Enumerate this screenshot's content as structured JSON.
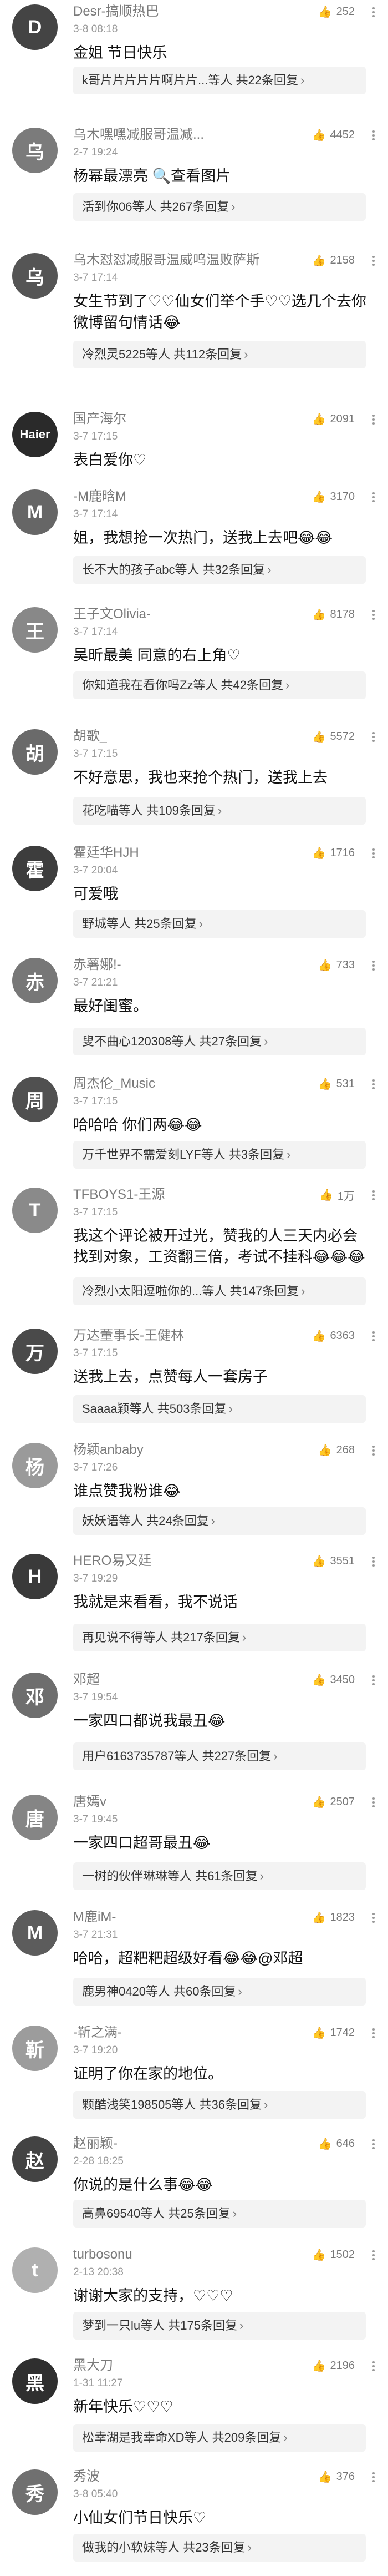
{
  "comments": [
    {
      "user": "Desr-搞顺热巴",
      "ts": "3-8 08:18",
      "likes": "252",
      "text": "金姐 节日快乐",
      "reply": "k哥片片片片片啊片片...等人  共22条回复"
    },
    {
      "user": "乌木嘿嘿减服哥温减...",
      "ts": "2-7 19:24",
      "likes": "4452",
      "text": "杨幂最漂亮 🔍查看图片",
      "reply": "活到你06等人  共267条回复"
    },
    {
      "user": "乌木怼怼减服哥温威呜温败萨斯",
      "ts": "3-7 17:14",
      "likes": "2158",
      "text": "女生节到了♡♡仙女们举个手♡♡选几个去你微博留句情话😂",
      "reply": "冷烈灵5225等人  共112条回复"
    },
    {
      "user": "国产海尔",
      "ts": "3-7 17:15",
      "likes": "2091",
      "text": "表白爱你♡",
      "reply": ""
    },
    {
      "user": "-M鹿晗M",
      "ts": "3-7 17:14",
      "likes": "3170",
      "text": "姐，我想抢一次热门，送我上去吧😂😂",
      "reply": "长不大的孩子abc等人  共32条回复"
    },
    {
      "user": "王子文Olivia-",
      "ts": "3-7 17:14",
      "likes": "8178",
      "text": "吴昕最美 同意的右上角♡",
      "reply": "你知道我在看你吗Zz等人  共42条回复"
    },
    {
      "user": "胡歌_",
      "ts": "3-7 17:15",
      "likes": "5572",
      "text": "不好意思，我也来抢个热门，送我上去",
      "reply": "花吃喵等人  共109条回复"
    },
    {
      "user": "霍廷华HJH",
      "ts": "3-7 20:04",
      "likes": "1716",
      "text": "可爱哦",
      "reply": "野城等人  共25条回复"
    },
    {
      "user": "赤薯娜!-",
      "ts": "3-7 21:21",
      "likes": "733",
      "text": "最好闺蜜。",
      "reply": "叟不曲心120308等人  共27条回复"
    },
    {
      "user": "周杰伦_Music",
      "ts": "3-7 17:15",
      "likes": "531",
      "text": "哈哈哈 你们两😂😂",
      "reply": "万千世界不需爱刻LYF等人  共3条回复"
    },
    {
      "user": "TFBOYS1-王源",
      "ts": "3-7 17:15",
      "likes": "1万",
      "text": "我这个评论被开过光，赞我的人三天内必会找到对象，工资翻三倍，考试不挂科😂😂😂",
      "reply": "冷烈小太阳逗啦你的...等人  共147条回复"
    },
    {
      "user": "万达董事长-王健林",
      "ts": "3-7 17:15",
      "likes": "6363",
      "text": "送我上去，点赞每人一套房子",
      "reply": "Saaaa颖等人  共503条回复"
    },
    {
      "user": "杨颖anbaby",
      "ts": "3-7 17:26",
      "likes": "268",
      "text": "谁点赞我粉谁😂",
      "reply": "妖妖语等人  共24条回复"
    },
    {
      "user": "HERO易又廷",
      "ts": "3-7 19:29",
      "likes": "3551",
      "text": "我就是来看看，我不说话",
      "reply": "再见说不得等人  共217条回复"
    },
    {
      "user": "邓超",
      "ts": "3-7 19:54",
      "likes": "3450",
      "text": "一家四口都说我最丑😂",
      "reply": "用户6163735787等人  共227条回复"
    },
    {
      "user": "唐嫣v",
      "ts": "3-7 19:45",
      "likes": "2507",
      "text": "一家四口超哥最丑😂",
      "reply": "一树的伙伴琳琳等人  共61条回复"
    },
    {
      "user": "M鹿iM-",
      "ts": "3-7 21:31",
      "likes": "1823",
      "text": "哈哈，超粑粑超级好看😂😂@邓超",
      "reply": "鹿男神0420等人  共60条回复"
    },
    {
      "user": "-靳之满-",
      "ts": "3-7 19:20",
      "likes": "1742",
      "text": "证明了你在家的地位。",
      "reply": "颗酷浅笑198505等人  共36条回复"
    },
    {
      "user": "赵丽颖-",
      "ts": "2-28 18:25",
      "likes": "646",
      "text": "你说的是什么事😂😂",
      "reply": "高鼻69540等人  共25条回复"
    },
    {
      "user": "turbosonu",
      "ts": "2-13 20:38",
      "likes": "1502",
      "text": "谢谢大家的支持，♡♡♡",
      "reply": "梦到一只lu等人  共175条回复"
    },
    {
      "user": "黑大刀",
      "ts": "1-31 11:27",
      "likes": "2196",
      "text": "新年快乐♡♡♡",
      "reply": "松幸湖是我幸命XD等人  共209条回复"
    },
    {
      "user": "秀波",
      "ts": "3-8 05:40",
      "likes": "376",
      "text": "小仙女们节日快乐♡",
      "reply": "做我的小软妹等人  共23条回复"
    }
  ]
}
